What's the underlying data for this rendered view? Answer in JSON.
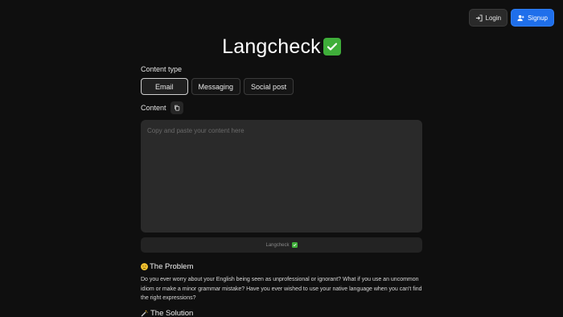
{
  "header": {
    "login_label": "Login",
    "signup_label": "Signup",
    "accent_color": "#1f6feb"
  },
  "app": {
    "title": "Langcheck",
    "title_emoji": "check-mark-button-icon"
  },
  "form": {
    "content_type_label": "Content type",
    "content_types": [
      "Email",
      "Messaging",
      "Social post"
    ],
    "selected_type": "Email",
    "content_label": "Content",
    "content_placeholder": "Copy and paste your content here",
    "submit_label": "Langcheck"
  },
  "sections": {
    "problem_title": "The Problem",
    "problem_text": "Do you ever worry about your English being seen as unprofessional or ignorant? What if you use an uncommon idiom or make a minor grammar mistake? Have you ever wished to use your native language when you can't find the right expressions?",
    "solution_title": "The Solution"
  }
}
